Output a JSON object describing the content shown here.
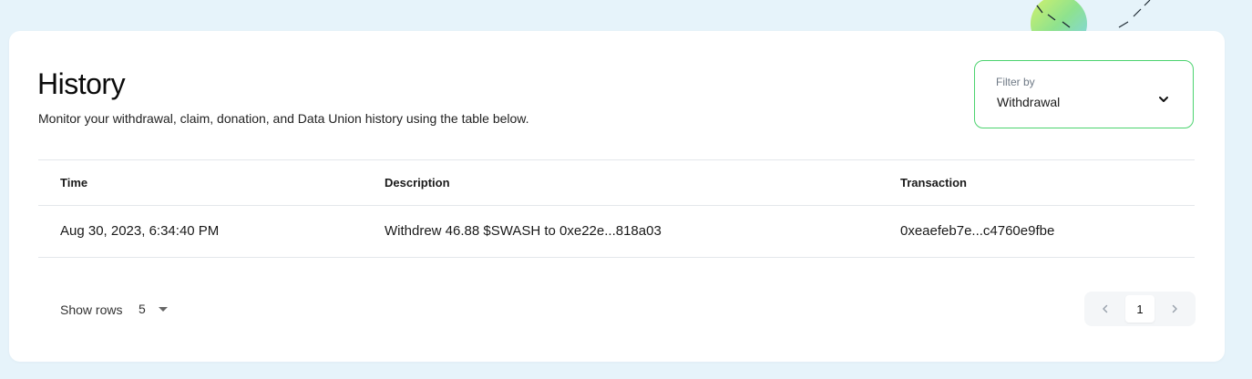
{
  "page": {
    "title": "History",
    "subtitle": "Monitor your withdrawal, claim, donation, and Data Union history using the table below."
  },
  "filter": {
    "label": "Filter by",
    "value": "Withdrawal",
    "icon": "chevron-down-icon",
    "border_color": "#4cd36f"
  },
  "table": {
    "headers": [
      "Time",
      "Description",
      "Transaction"
    ],
    "rows": [
      {
        "time": "Aug 30, 2023, 6:34:40 PM",
        "description": "Withdrew 46.88 $SWASH to 0xe22e...818a03",
        "transaction": "0xeaefeb7e...c4760e9fbe"
      }
    ]
  },
  "pagination": {
    "show_rows_label": "Show rows",
    "rows_per_page": "5",
    "current_page": "1",
    "prev_icon": "chevron-left-icon",
    "next_icon": "chevron-right-icon"
  },
  "colors": {
    "background": "#e6f3fa",
    "card": "#ffffff",
    "accent_green": "#4cd36f"
  }
}
